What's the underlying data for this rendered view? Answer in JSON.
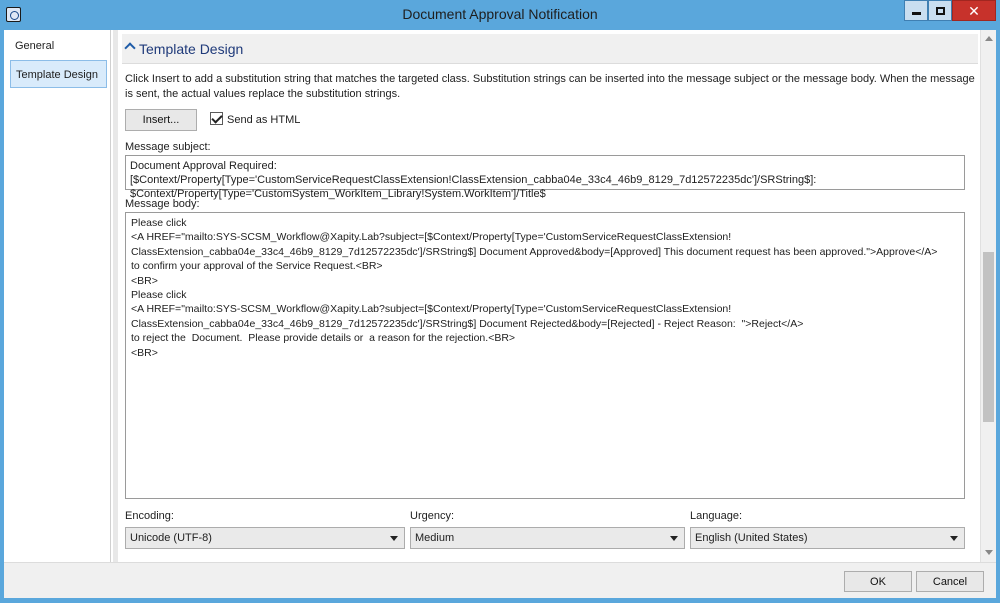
{
  "window": {
    "title": "Document Approval Notification",
    "close_glyph": "✕",
    "icons": [
      "app-icon",
      "minimize-icon",
      "maximize-icon",
      "close-icon"
    ]
  },
  "nav": {
    "items": [
      {
        "label": "General",
        "selected": false
      },
      {
        "label": "Template Design",
        "selected": true
      }
    ]
  },
  "section": {
    "title": "Template Design",
    "description": "Click Insert to add a substitution string that matches the targeted class. Substitution strings can be inserted into the message subject or the message body. When the message is sent, the actual values replace the substitution strings."
  },
  "toolbar": {
    "insert_label": "Insert...",
    "send_html_label": "Send as HTML",
    "send_html_checked": true
  },
  "subject": {
    "label": "Message subject:",
    "value": "Document Approval Required:  [$Context/Property[Type='CustomServiceRequestClassExtension!ClassExtension_cabba04e_33c4_46b9_8129_7d12572235dc']/SRString$]:\n$Context/Property[Type='CustomSystem_WorkItem_Library!System.WorkItem']/Title$"
  },
  "body": {
    "label": "Message body:",
    "value": "Please click\n<A HREF=\"mailto:SYS-SCSM_Workflow@Xapity.Lab?subject=[$Context/Property[Type='CustomServiceRequestClassExtension!\nClassExtension_cabba04e_33c4_46b9_8129_7d12572235dc']/SRString$] Document Approved&body=[Approved] This document request has been approved.\">Approve</A>\nto confirm your approval of the Service Request.<BR>\n<BR>\nPlease click\n<A HREF=\"mailto:SYS-SCSM_Workflow@Xapity.Lab?subject=[$Context/Property[Type='CustomServiceRequestClassExtension!\nClassExtension_cabba04e_33c4_46b9_8129_7d12572235dc']/SRString$] Document Rejected&body=[Rejected] - Reject Reason:  \">Reject</A>\nto reject the  Document.  Please provide details or  a reason for the rejection.<BR>\n<BR>"
  },
  "options": {
    "encoding": {
      "label": "Encoding:",
      "value": "Unicode (UTF-8)"
    },
    "urgency": {
      "label": "Urgency:",
      "value": "Medium"
    },
    "language": {
      "label": "Language:",
      "value": "English (United States)"
    }
  },
  "footer": {
    "ok_label": "OK",
    "cancel_label": "Cancel"
  },
  "colors": {
    "titlebar": "#5aa7dc",
    "close_button": "#c7322b",
    "nav_selected": "#d9ebfb",
    "section_title": "#1f3a7a"
  }
}
